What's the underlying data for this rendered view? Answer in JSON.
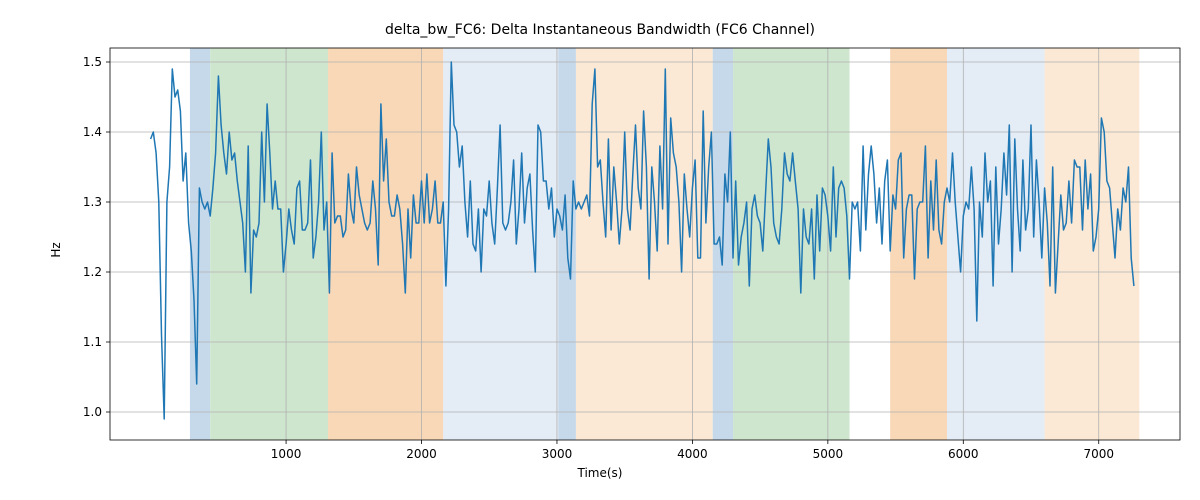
{
  "chart_data": {
    "type": "line",
    "title": "delta_bw_FC6: Delta Instantaneous Bandwidth (FC6 Channel)",
    "xlabel": "Time(s)",
    "ylabel": "Hz",
    "xlim": [
      -300,
      7600
    ],
    "ylim": [
      0.96,
      1.52
    ],
    "xticks": [
      1000,
      2000,
      3000,
      4000,
      5000,
      6000,
      7000
    ],
    "yticks": [
      1.0,
      1.1,
      1.2,
      1.3,
      1.4,
      1.5
    ],
    "background_bands": [
      {
        "x0": 290,
        "x1": 440,
        "color": "#c5d9eb"
      },
      {
        "x0": 440,
        "x1": 1310,
        "color": "#cee6ce"
      },
      {
        "x0": 1310,
        "x1": 2160,
        "color": "#f8d8b7"
      },
      {
        "x0": 2160,
        "x1": 3010,
        "color": "#e4ecf5"
      },
      {
        "x0": 3010,
        "x1": 3140,
        "color": "#c5d9eb"
      },
      {
        "x0": 3140,
        "x1": 4150,
        "color": "#fbe9d5"
      },
      {
        "x0": 4150,
        "x1": 4300,
        "color": "#c5d9eb"
      },
      {
        "x0": 4300,
        "x1": 5160,
        "color": "#cee6ce"
      },
      {
        "x0": 5160,
        "x1": 5460,
        "color": "#ffffff"
      },
      {
        "x0": 5460,
        "x1": 5880,
        "color": "#f8d8b7"
      },
      {
        "x0": 5880,
        "x1": 6600,
        "color": "#e4ecf5"
      },
      {
        "x0": 6600,
        "x1": 7300,
        "color": "#fbe9d5"
      }
    ],
    "x": [
      0,
      20,
      40,
      60,
      80,
      100,
      120,
      140,
      160,
      180,
      200,
      220,
      240,
      260,
      280,
      300,
      320,
      340,
      360,
      380,
      400,
      420,
      440,
      460,
      480,
      500,
      520,
      540,
      560,
      580,
      600,
      620,
      640,
      660,
      680,
      700,
      720,
      740,
      760,
      780,
      800,
      820,
      840,
      860,
      880,
      900,
      920,
      940,
      960,
      980,
      1000,
      1020,
      1040,
      1060,
      1080,
      1100,
      1120,
      1140,
      1160,
      1180,
      1200,
      1220,
      1240,
      1260,
      1280,
      1300,
      1320,
      1340,
      1360,
      1380,
      1400,
      1420,
      1440,
      1460,
      1480,
      1500,
      1520,
      1540,
      1560,
      1580,
      1600,
      1620,
      1640,
      1660,
      1680,
      1700,
      1720,
      1740,
      1760,
      1780,
      1800,
      1820,
      1840,
      1860,
      1880,
      1900,
      1920,
      1940,
      1960,
      1980,
      2000,
      2020,
      2040,
      2060,
      2080,
      2100,
      2120,
      2140,
      2160,
      2180,
      2200,
      2220,
      2240,
      2260,
      2280,
      2300,
      2320,
      2340,
      2360,
      2380,
      2400,
      2420,
      2440,
      2460,
      2480,
      2500,
      2520,
      2540,
      2560,
      2580,
      2600,
      2620,
      2640,
      2660,
      2680,
      2700,
      2720,
      2740,
      2760,
      2780,
      2800,
      2820,
      2840,
      2860,
      2880,
      2900,
      2920,
      2940,
      2960,
      2980,
      3000,
      3020,
      3040,
      3060,
      3080,
      3100,
      3120,
      3140,
      3160,
      3180,
      3200,
      3220,
      3240,
      3260,
      3280,
      3300,
      3320,
      3340,
      3360,
      3380,
      3400,
      3420,
      3440,
      3460,
      3480,
      3500,
      3520,
      3540,
      3560,
      3580,
      3600,
      3620,
      3640,
      3660,
      3680,
      3700,
      3720,
      3740,
      3760,
      3780,
      3800,
      3820,
      3840,
      3860,
      3880,
      3900,
      3920,
      3940,
      3960,
      3980,
      4000,
      4020,
      4040,
      4060,
      4080,
      4100,
      4120,
      4140,
      4160,
      4180,
      4200,
      4220,
      4240,
      4260,
      4280,
      4300,
      4320,
      4340,
      4360,
      4380,
      4400,
      4420,
      4440,
      4460,
      4480,
      4500,
      4520,
      4540,
      4560,
      4580,
      4600,
      4620,
      4640,
      4660,
      4680,
      4700,
      4720,
      4740,
      4760,
      4780,
      4800,
      4820,
      4840,
      4860,
      4880,
      4900,
      4920,
      4940,
      4960,
      4980,
      5000,
      5020,
      5040,
      5060,
      5080,
      5100,
      5120,
      5140,
      5160,
      5180,
      5200,
      5220,
      5240,
      5260,
      5280,
      5300,
      5320,
      5340,
      5360,
      5380,
      5400,
      5420,
      5440,
      5460,
      5480,
      5500,
      5520,
      5540,
      5560,
      5580,
      5600,
      5620,
      5640,
      5660,
      5680,
      5700,
      5720,
      5740,
      5760,
      5780,
      5800,
      5820,
      5840,
      5860,
      5880,
      5900,
      5920,
      5940,
      5960,
      5980,
      6000,
      6020,
      6040,
      6060,
      6080,
      6100,
      6120,
      6140,
      6160,
      6180,
      6200,
      6220,
      6240,
      6260,
      6280,
      6300,
      6320,
      6340,
      6360,
      6380,
      6400,
      6420,
      6440,
      6460,
      6480,
      6500,
      6520,
      6540,
      6560,
      6580,
      6600,
      6620,
      6640,
      6660,
      6680,
      6700,
      6720,
      6740,
      6760,
      6780,
      6800,
      6820,
      6840,
      6860,
      6880,
      6900,
      6920,
      6940,
      6960,
      6980,
      7000,
      7020,
      7040,
      7060,
      7080,
      7100,
      7120,
      7140,
      7160,
      7180,
      7200,
      7220,
      7240,
      7260
    ],
    "values": [
      1.39,
      1.4,
      1.37,
      1.3,
      1.11,
      0.99,
      1.3,
      1.35,
      1.49,
      1.45,
      1.46,
      1.43,
      1.33,
      1.37,
      1.27,
      1.23,
      1.16,
      1.04,
      1.32,
      1.3,
      1.29,
      1.3,
      1.28,
      1.32,
      1.37,
      1.48,
      1.41,
      1.37,
      1.34,
      1.4,
      1.36,
      1.37,
      1.33,
      1.3,
      1.27,
      1.2,
      1.38,
      1.17,
      1.26,
      1.25,
      1.27,
      1.4,
      1.3,
      1.44,
      1.37,
      1.29,
      1.33,
      1.29,
      1.29,
      1.2,
      1.24,
      1.29,
      1.26,
      1.24,
      1.32,
      1.33,
      1.26,
      1.26,
      1.27,
      1.36,
      1.22,
      1.25,
      1.3,
      1.4,
      1.26,
      1.3,
      1.17,
      1.37,
      1.27,
      1.28,
      1.28,
      1.25,
      1.26,
      1.34,
      1.29,
      1.27,
      1.35,
      1.31,
      1.29,
      1.27,
      1.26,
      1.27,
      1.33,
      1.29,
      1.21,
      1.44,
      1.33,
      1.39,
      1.3,
      1.28,
      1.28,
      1.31,
      1.29,
      1.24,
      1.17,
      1.29,
      1.22,
      1.31,
      1.27,
      1.27,
      1.33,
      1.27,
      1.34,
      1.27,
      1.29,
      1.33,
      1.27,
      1.27,
      1.3,
      1.18,
      1.29,
      1.5,
      1.41,
      1.4,
      1.35,
      1.38,
      1.3,
      1.25,
      1.33,
      1.24,
      1.23,
      1.29,
      1.2,
      1.29,
      1.28,
      1.33,
      1.27,
      1.24,
      1.32,
      1.41,
      1.27,
      1.26,
      1.27,
      1.3,
      1.36,
      1.24,
      1.29,
      1.37,
      1.27,
      1.32,
      1.34,
      1.26,
      1.2,
      1.41,
      1.4,
      1.33,
      1.33,
      1.29,
      1.32,
      1.25,
      1.29,
      1.28,
      1.26,
      1.31,
      1.22,
      1.19,
      1.33,
      1.29,
      1.3,
      1.29,
      1.3,
      1.31,
      1.28,
      1.44,
      1.49,
      1.35,
      1.36,
      1.3,
      1.25,
      1.39,
      1.26,
      1.35,
      1.3,
      1.24,
      1.29,
      1.4,
      1.29,
      1.26,
      1.34,
      1.41,
      1.32,
      1.29,
      1.43,
      1.35,
      1.19,
      1.35,
      1.3,
      1.23,
      1.38,
      1.29,
      1.49,
      1.24,
      1.42,
      1.37,
      1.35,
      1.3,
      1.2,
      1.34,
      1.29,
      1.25,
      1.32,
      1.36,
      1.22,
      1.22,
      1.43,
      1.27,
      1.35,
      1.4,
      1.24,
      1.24,
      1.25,
      1.21,
      1.34,
      1.3,
      1.4,
      1.22,
      1.33,
      1.21,
      1.25,
      1.27,
      1.3,
      1.18,
      1.29,
      1.31,
      1.28,
      1.27,
      1.23,
      1.31,
      1.39,
      1.35,
      1.27,
      1.25,
      1.24,
      1.29,
      1.37,
      1.34,
      1.33,
      1.37,
      1.33,
      1.29,
      1.17,
      1.29,
      1.25,
      1.24,
      1.29,
      1.19,
      1.31,
      1.23,
      1.32,
      1.31,
      1.28,
      1.23,
      1.35,
      1.25,
      1.32,
      1.33,
      1.32,
      1.28,
      1.19,
      1.3,
      1.29,
      1.3,
      1.23,
      1.38,
      1.26,
      1.34,
      1.38,
      1.34,
      1.27,
      1.32,
      1.24,
      1.33,
      1.36,
      1.23,
      1.31,
      1.29,
      1.36,
      1.37,
      1.22,
      1.29,
      1.31,
      1.31,
      1.19,
      1.29,
      1.3,
      1.3,
      1.38,
      1.22,
      1.33,
      1.26,
      1.36,
      1.26,
      1.24,
      1.3,
      1.32,
      1.3,
      1.37,
      1.3,
      1.25,
      1.2,
      1.28,
      1.3,
      1.29,
      1.35,
      1.29,
      1.13,
      1.3,
      1.25,
      1.37,
      1.3,
      1.33,
      1.18,
      1.35,
      1.24,
      1.29,
      1.37,
      1.31,
      1.41,
      1.2,
      1.39,
      1.29,
      1.23,
      1.36,
      1.26,
      1.29,
      1.41,
      1.25,
      1.36,
      1.3,
      1.22,
      1.32,
      1.27,
      1.18,
      1.35,
      1.17,
      1.24,
      1.31,
      1.26,
      1.27,
      1.33,
      1.27,
      1.36,
      1.35,
      1.35,
      1.26,
      1.36,
      1.29,
      1.34,
      1.23,
      1.25,
      1.29,
      1.42,
      1.4,
      1.33,
      1.32,
      1.27,
      1.22,
      1.29,
      1.26,
      1.32,
      1.3,
      1.35,
      1.22,
      1.18
    ]
  }
}
